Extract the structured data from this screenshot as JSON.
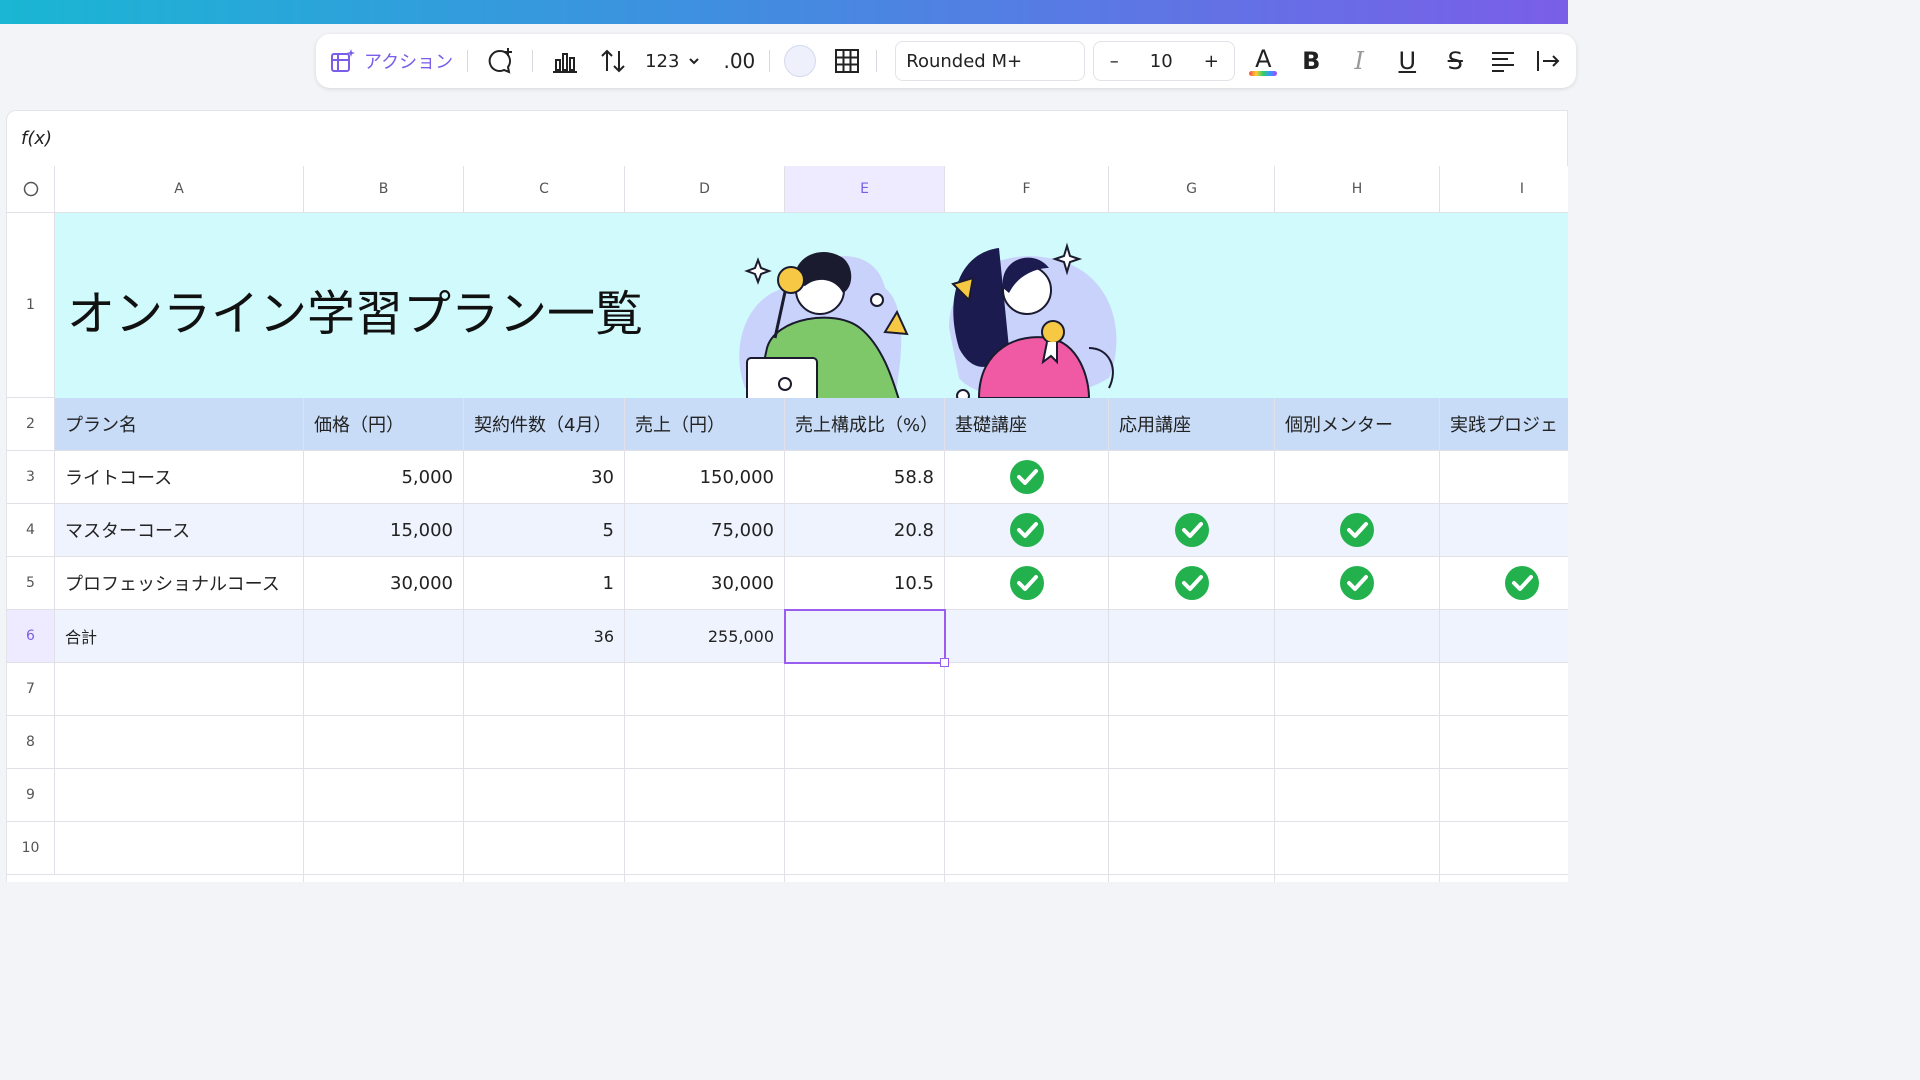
{
  "toolbar": {
    "action_label": "アクション",
    "number_format": "123",
    "decimal_label": ".00",
    "font_name": "Rounded M+",
    "font_size": "10",
    "minus": "–",
    "plus": "+",
    "bold": "B",
    "italic": "I",
    "underline": "U",
    "strike": "S",
    "text_color_letter": "A"
  },
  "formula_bar": {
    "label": "f(x)"
  },
  "sheet": {
    "columns": [
      "A",
      "B",
      "C",
      "D",
      "E",
      "F",
      "G",
      "H",
      "I"
    ],
    "rows": [
      "1",
      "2",
      "3",
      "4",
      "5",
      "6",
      "7",
      "8",
      "9",
      "10"
    ],
    "selected_column": "E",
    "selected_row": "6",
    "title": "オンライン学習プラン一覧",
    "headers": [
      "プラン名",
      "価格（円）",
      "契約件数（4月）",
      "売上（円）",
      "売上構成比（%）",
      "基礎講座",
      "応用講座",
      "個別メンター",
      "実践プロジェ"
    ],
    "data_rows": [
      {
        "name": "ライトコース",
        "price": "5,000",
        "count": "30",
        "sales": "150,000",
        "ratio": "58.8",
        "checks": [
          true,
          false,
          false,
          false
        ]
      },
      {
        "name": "マスターコース",
        "price": "15,000",
        "count": "5",
        "sales": "75,000",
        "ratio": "20.8",
        "checks": [
          true,
          true,
          true,
          false
        ]
      },
      {
        "name": "プロフェッショナルコース",
        "price": "30,000",
        "count": "1",
        "sales": "30,000",
        "ratio": "10.5",
        "checks": [
          true,
          true,
          true,
          true
        ]
      }
    ],
    "total_row": {
      "name": "合計",
      "count": "36",
      "sales": "255,000"
    }
  },
  "colors": {
    "accent": "#7a5ee8",
    "header_fill": "#c8dcf7",
    "title_fill": "#d0fafb",
    "check_green": "#22b14c"
  }
}
